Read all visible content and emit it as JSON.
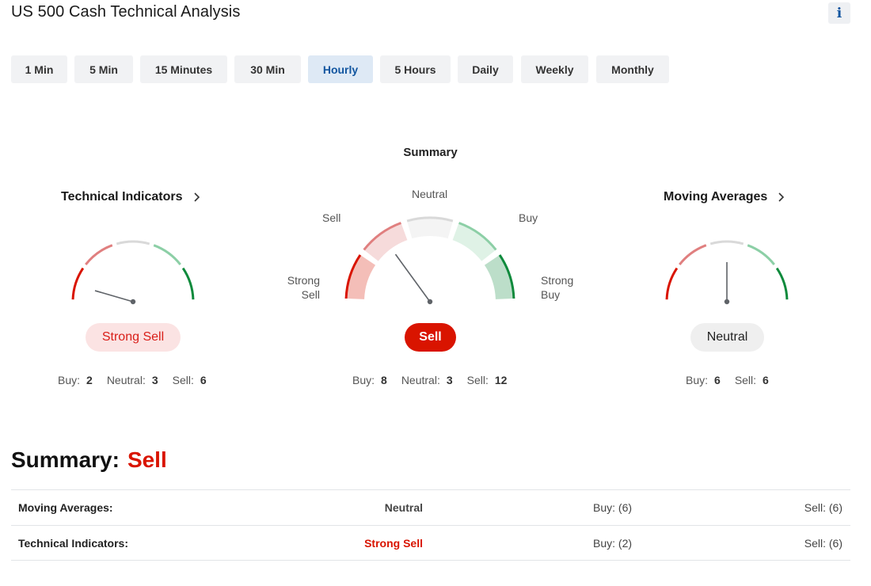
{
  "page": {
    "title": "US 500 Cash Technical Analysis",
    "info_icon": "info-icon",
    "info_label": "i"
  },
  "tabs": [
    {
      "label": "1 Min",
      "active": false
    },
    {
      "label": "5 Min",
      "active": false
    },
    {
      "label": "15 Minutes",
      "active": false
    },
    {
      "label": "30 Min",
      "active": false
    },
    {
      "label": "Hourly",
      "active": true
    },
    {
      "label": "5 Hours",
      "active": false
    },
    {
      "label": "Daily",
      "active": false
    },
    {
      "label": "Weekly",
      "active": false
    },
    {
      "label": "Monthly",
      "active": false
    }
  ],
  "summary_gauge": {
    "title": "Summary",
    "labels": {
      "neutral": "Neutral",
      "sell": "Sell",
      "buy": "Buy",
      "strong_sell_1": "Strong",
      "strong_sell_2": "Sell",
      "strong_buy_1": "Strong",
      "strong_buy_2": "Buy"
    },
    "needle_value": 0.3,
    "badge": "Sell",
    "counts": {
      "buy_label": "Buy:",
      "buy": "8",
      "neutral_label": "Neutral:",
      "neutral": "3",
      "sell_label": "Sell:",
      "sell": "12"
    }
  },
  "technical_indicators": {
    "title": "Technical Indicators",
    "needle_value": 0.09,
    "badge": "Strong Sell",
    "counts": {
      "buy_label": "Buy:",
      "buy": "2",
      "neutral_label": "Neutral:",
      "neutral": "3",
      "sell_label": "Sell:",
      "sell": "6"
    }
  },
  "moving_averages": {
    "title": "Moving Averages",
    "needle_value": 0.5,
    "badge": "Neutral",
    "counts": {
      "buy_label": "Buy:",
      "buy": "6",
      "sell_label": "Sell:",
      "sell": "6"
    }
  },
  "summary": {
    "label": "Summary:",
    "value": "Sell",
    "rows": [
      {
        "name": "Moving Averages:",
        "value": "Neutral",
        "buy": "Buy: (6)",
        "sell": "Sell: (6)"
      },
      {
        "name": "Technical Indicators:",
        "value": "Strong Sell",
        "buy": "Buy: (2)",
        "sell": "Sell: (6)"
      }
    ]
  },
  "colors": {
    "strong_sell": "#d91400",
    "sell": "#e07f7f",
    "neutral": "#d9d9d9",
    "buy": "#8ccfa6",
    "strong_buy": "#0f8a3c",
    "active_tab_bg": "#dee9f5",
    "active_tab_text": "#1256a0",
    "needle": "#5f6368"
  }
}
